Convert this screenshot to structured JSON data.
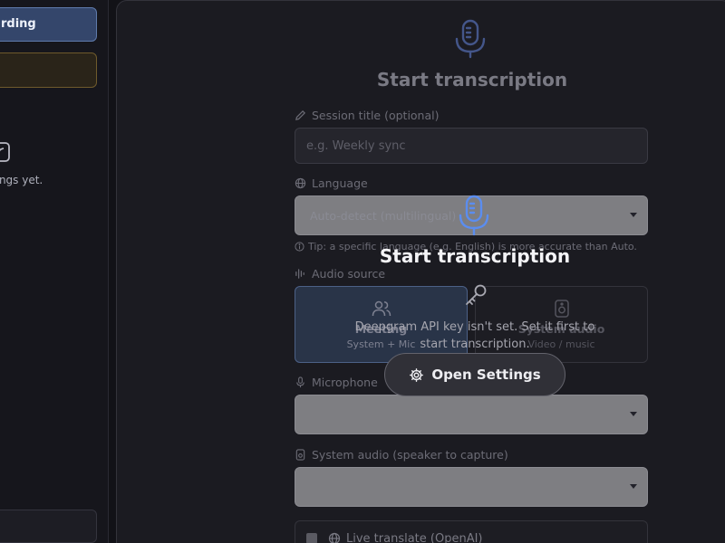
{
  "sidebar": {
    "record_button_label": "rding",
    "empty_text": "dings yet."
  },
  "form": {
    "hero_title": "Start transcription",
    "session_title_label": "Session title (optional)",
    "session_title_placeholder": "e.g. Weekly sync",
    "language_label": "Language",
    "language_value": "Auto-detect (multilingual)",
    "language_tip": "Tip: a specific language (e.g. English) is more accurate than Auto.",
    "audio_source_label": "Audio source",
    "sources": [
      {
        "name": "Meeting",
        "sub": "System + Mic"
      },
      {
        "name": "System audio",
        "sub": "Video / music"
      }
    ],
    "microphone_label": "Microphone",
    "system_audio_label": "System audio (speaker to capture)",
    "live_translate_label": "Live translate (OpenAI)"
  },
  "overlay": {
    "title": "Start transcription",
    "message": "Deepgram API key isn't set. Set it first to start transcription.",
    "button_label": "Open Settings"
  },
  "colors": {
    "accent": "#5b8def",
    "record_button_bg": "#34466b",
    "warning_border": "#6e5a2c",
    "panel_bg": "#1b1b21"
  },
  "icons": {
    "hero": "microphone-icon",
    "session": "pencil-icon",
    "language": "globe-icon",
    "tip": "info-icon",
    "audio": "waveform-icon",
    "meeting": "users-icon",
    "system": "speaker-icon",
    "microphone": "microphone-icon",
    "system_audio": "speaker-icon",
    "overlay_key": "key-icon",
    "settings": "gear-icon"
  }
}
